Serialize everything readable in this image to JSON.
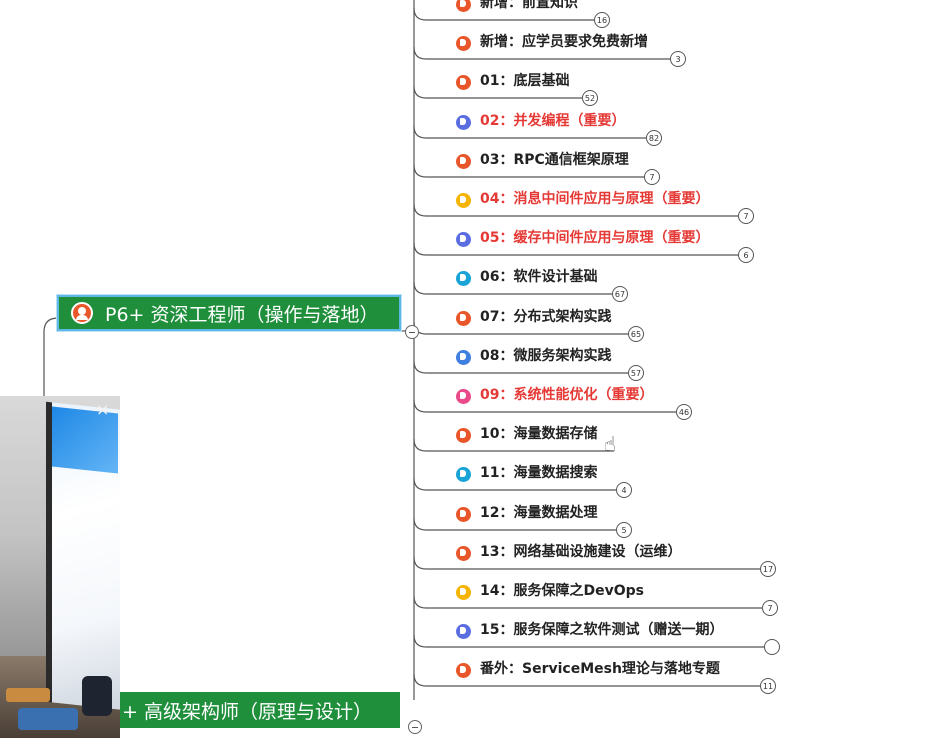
{
  "main_nodes": {
    "p6": {
      "label": "P6+ 资深工程师（操作与落地）"
    },
    "p7": {
      "label": "+ 高级架构师（原理与设计）"
    }
  },
  "children": [
    {
      "label": "新增：前置知识",
      "badge": "16",
      "icon_color": "#e8562a",
      "highlight": false
    },
    {
      "label": "新增：应学员要求免费新增",
      "badge": "3",
      "icon_color": "#e8562a",
      "highlight": false
    },
    {
      "label": "01：底层基础",
      "badge": "52",
      "icon_color": "#e8562a",
      "highlight": false
    },
    {
      "label": "02：并发编程（重要）",
      "badge": "82",
      "icon_color": "#5b6ee1",
      "highlight": true
    },
    {
      "label": "03：RPC通信框架原理",
      "badge": "7",
      "icon_color": "#e8562a",
      "highlight": false
    },
    {
      "label": "04：消息中间件应用与原理（重要）",
      "badge": "7",
      "icon_color": "#f4b400",
      "highlight": true
    },
    {
      "label": "05：缓存中间件应用与原理（重要）",
      "badge": "6",
      "icon_color": "#5b6ee1",
      "highlight": true
    },
    {
      "label": "06：软件设计基础",
      "badge": "67",
      "icon_color": "#1aa3d6",
      "highlight": false
    },
    {
      "label": "07：分布式架构实践",
      "badge": "65",
      "icon_color": "#e8562a",
      "highlight": false
    },
    {
      "label": "08：微服务架构实践",
      "badge": "57",
      "icon_color": "#3f7fe0",
      "highlight": false
    },
    {
      "label": "09：系统性能优化（重要）",
      "badge": "46",
      "icon_color": "#e94a8a",
      "highlight": true
    },
    {
      "label": "10：海量数据存储",
      "badge": "",
      "icon_color": "#e8562a",
      "highlight": false
    },
    {
      "label": "11：海量数据搜索",
      "badge": "4",
      "icon_color": "#1aa3d6",
      "highlight": false
    },
    {
      "label": "12：海量数据处理",
      "badge": "5",
      "icon_color": "#e8562a",
      "highlight": false
    },
    {
      "label": "13：网络基础设施建设（运维）",
      "badge": "17",
      "icon_color": "#e8562a",
      "highlight": false
    },
    {
      "label": "14：服务保障之DevOps",
      "badge": "7",
      "icon_color": "#f4b400",
      "highlight": false
    },
    {
      "label": "15：服务保障之软件测试（赠送一期）",
      "badge": "",
      "icon_color": "#5b6ee1",
      "highlight": false
    },
    {
      "label": "番外：ServiceMesh理论与落地专题",
      "badge": "11",
      "icon_color": "#e8562a",
      "highlight": false
    }
  ],
  "webcam": {
    "close_glyph": "×"
  },
  "colors": {
    "main_node_bg": "#1f8f3c",
    "main_node_border": "#5fb7e6",
    "highlight_text": "#e53935",
    "connector": "#555555"
  }
}
